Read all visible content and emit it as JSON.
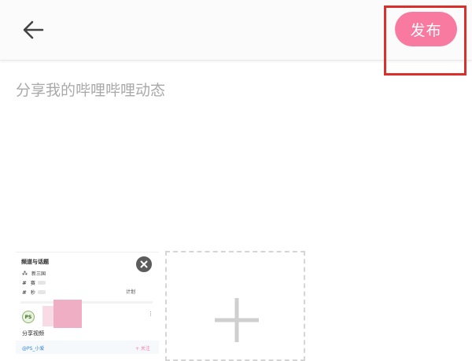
{
  "header": {
    "back_icon": "arrow-left-icon",
    "publish_label": "发布",
    "publish_color": "#f87aa0",
    "highlight_color": "#d9302b"
  },
  "compose": {
    "placeholder": "分享我的哔哩哔哩动态"
  },
  "attachment": {
    "title": "频道与话题",
    "rows": [
      {
        "icon": "people-icon",
        "text": "新三国"
      },
      {
        "icon": "hashtag-icon",
        "text": "赛"
      },
      {
        "icon": "hashtag-icon",
        "text": "秒"
      }
    ],
    "plan_text": "计划",
    "logo_text": "PS",
    "caption": "分享视频",
    "user": "@PS_小爱",
    "follow": "+ 关注",
    "remove_icon": "close-icon"
  },
  "add_media": {
    "icon": "plus-icon"
  }
}
